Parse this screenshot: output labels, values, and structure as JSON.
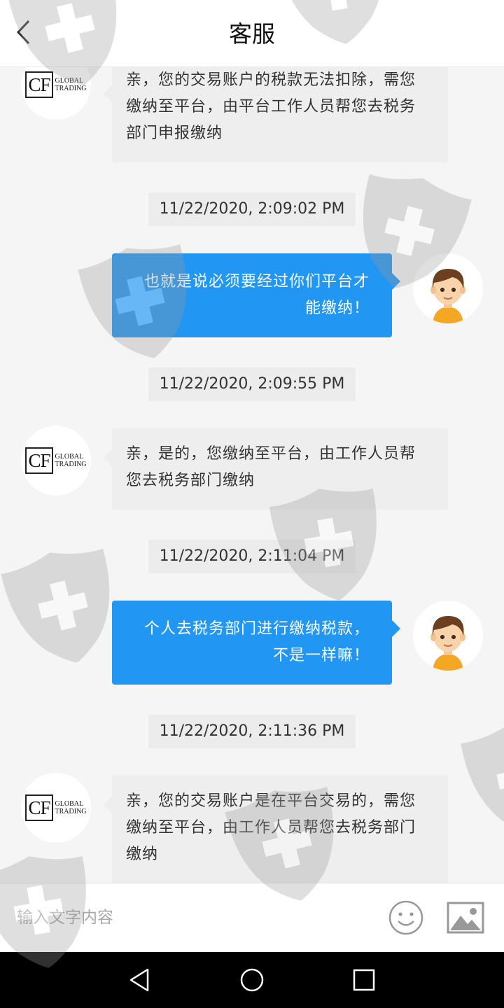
{
  "header": {
    "title": "客服",
    "back_icon": "chevron-left-icon"
  },
  "messages": [
    {
      "type": "text",
      "sender": "agent",
      "lines": [
        "亲，您的交易账户的税款无法扣除，需您",
        "缴纳至平台，由平台工作人员帮您去税务",
        "部门申报缴纳"
      ]
    },
    {
      "type": "timestamp",
      "text": "11/22/2020, 2:09:02 PM"
    },
    {
      "type": "text",
      "sender": "user",
      "lines": [
        "也就是说必须要经过你们平台才",
        "能缴纳！"
      ]
    },
    {
      "type": "timestamp",
      "text": "11/22/2020, 2:09:55 PM"
    },
    {
      "type": "text",
      "sender": "agent",
      "lines": [
        "亲，是的，您缴纳至平台，由工作人员帮",
        "您去税务部门缴纳"
      ]
    },
    {
      "type": "timestamp",
      "text": "11/22/2020, 2:11:04 PM"
    },
    {
      "type": "text",
      "sender": "user",
      "lines": [
        "个人去税务部门进行缴纳税款，",
        "不是一样嘛！"
      ]
    },
    {
      "type": "timestamp",
      "text": "11/22/2020, 2:11:36 PM"
    },
    {
      "type": "text",
      "sender": "agent",
      "lines": [
        "亲，您的交易账户是在平台交易的，需您",
        "缴纳至平台，由工作人员帮您去税务部门",
        "缴纳"
      ]
    }
  ],
  "agent_logo": {
    "mark": "CF",
    "line1": "GLOBAL",
    "line2": "TRADING"
  },
  "input": {
    "placeholder": "输入文字内容",
    "value": ""
  },
  "input_icons": [
    "emoji-icon",
    "image-icon"
  ],
  "nav_icons": [
    "back-triangle-icon",
    "home-circle-icon",
    "recents-square-icon"
  ],
  "colors": {
    "user_bubble": "#2196f3",
    "agent_bubble": "#eeeeee",
    "header_bg": "#ffffff",
    "navbar_bg": "#000000"
  }
}
